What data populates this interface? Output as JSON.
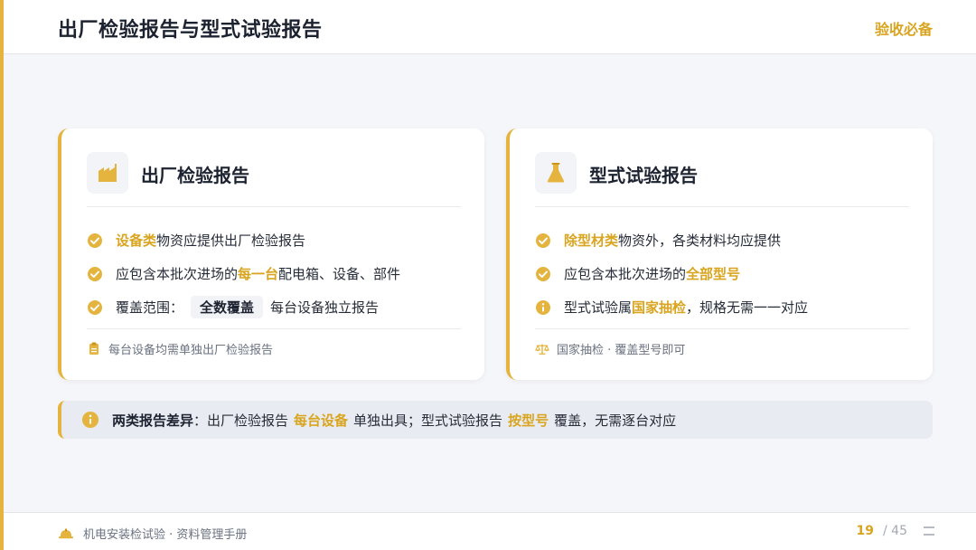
{
  "header": {
    "title": "出厂检验报告与型式试验报告",
    "badge": "验收必备"
  },
  "card_factory": {
    "icon": "factory-icon",
    "title": "出厂检验报告",
    "items": [
      {
        "icon": "check-circle-icon",
        "hl": "设备类",
        "text": "物资应提供出厂检验报告"
      },
      {
        "icon": "check-circle-icon",
        "pre": "应包含本批次进场的",
        "hl": "每一台",
        "post": "配电箱、设备、部件"
      },
      {
        "icon": "check-circle-icon",
        "pre": "覆盖范围：",
        "pill": "全数覆盖",
        "post": "每台设备独立报告"
      }
    ],
    "note": {
      "icon": "clipboard-icon",
      "text": "每台设备均需单独出厂检验报告"
    }
  },
  "card_type": {
    "icon": "flask-icon",
    "title": "型式试验报告",
    "items": [
      {
        "icon": "check-circle-icon",
        "hl": "除型材类",
        "text": "物资外，各类材料均应提供"
      },
      {
        "icon": "check-circle-icon",
        "pre": "应包含本批次进场的",
        "hl": "全部型号"
      },
      {
        "icon": "info-circle-icon",
        "pre": "型式试验属",
        "hl": "国家抽检",
        "post": "，规格无需一一对应"
      }
    ],
    "note": {
      "icon": "scale-icon",
      "text": "国家抽检 · 覆盖型号即可"
    }
  },
  "banner": {
    "icon": "info-circle-icon",
    "title": "两类报告差异",
    "part1": "：出厂检验报告",
    "hl1": "每台设备",
    "part2": "单独出具；型式试验报告",
    "hl2": "按型号",
    "part3": "覆盖，无需逐台对应"
  },
  "footer": {
    "icon": "hardhat-icon",
    "text": "机电安装检试验 · 资料管理手册",
    "page_current": "19",
    "page_total": "/ 45",
    "menu_icon": "menu-icon"
  },
  "colors": {
    "accent": "#e4b43f",
    "highlight": "#d9a520",
    "banner_bg": "#e8ebf1"
  }
}
